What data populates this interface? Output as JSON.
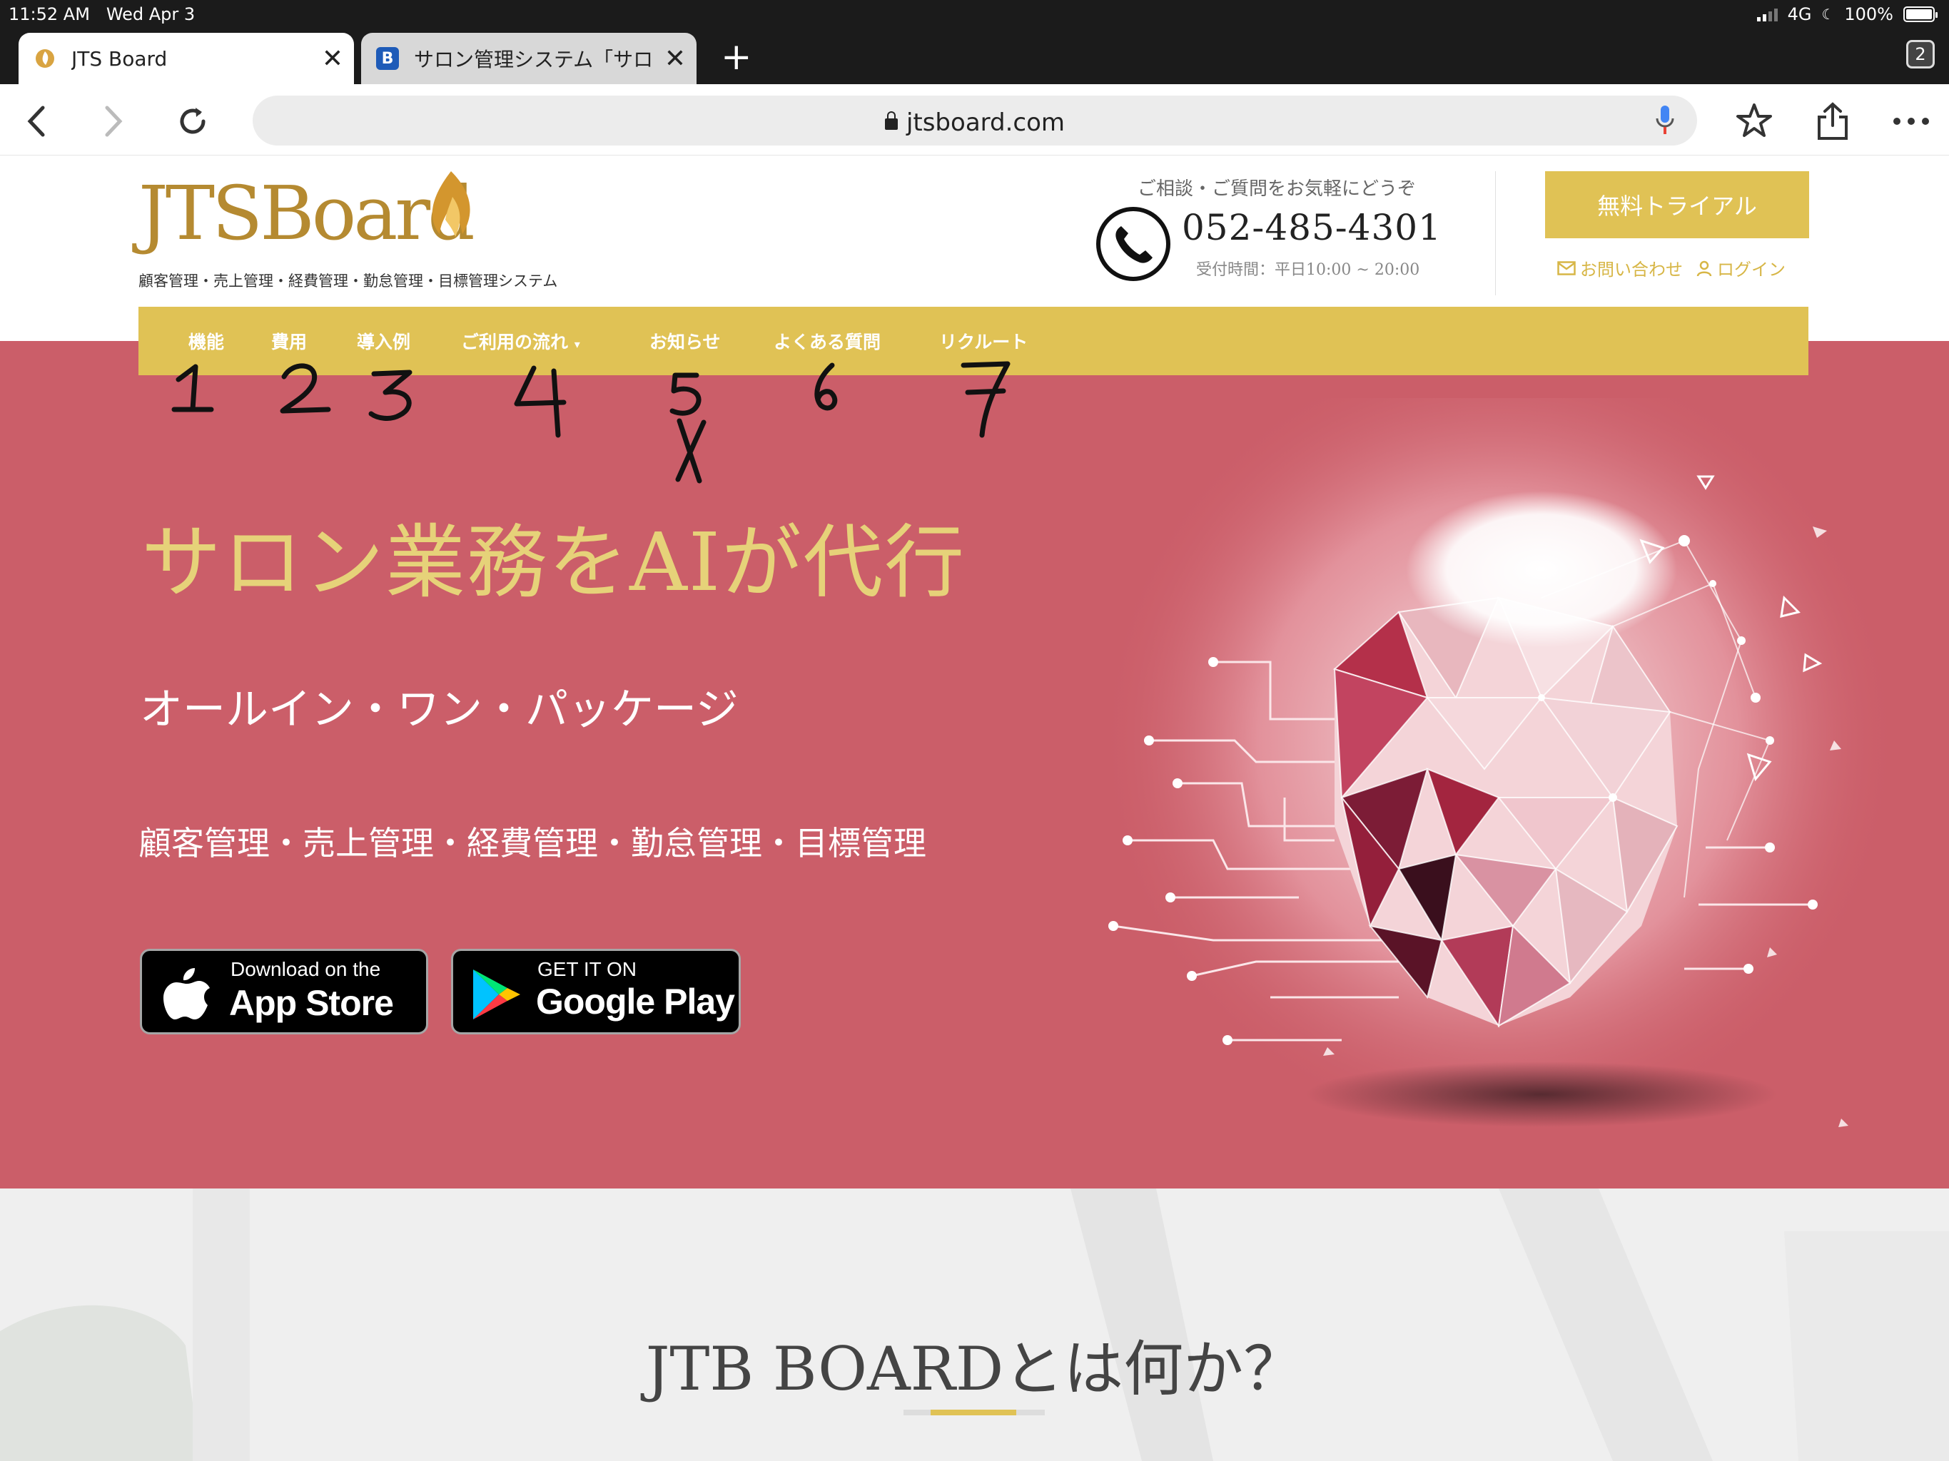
{
  "status": {
    "time": "11:52 AM",
    "date": "Wed Apr 3",
    "network": "4G",
    "battery": "100%"
  },
  "tabs": [
    {
      "title": "JTS Board",
      "favicon": "jts-flame-icon"
    },
    {
      "title": "サロン管理システム「サロ",
      "favicon": "b-icon"
    }
  ],
  "tab_count": "2",
  "address": {
    "url": "jtsboard.com"
  },
  "site": {
    "logo_text": "JTSBoard",
    "tagline": "顧客管理・売上管理・経費管理・勤怠管理・目標管理システム",
    "contact_prompt": "ご相談・ご質問をお気軽にどうぞ",
    "phone": "052-485-4301",
    "hours": "受付時間：平日10:00 ~ 20:00",
    "trial_button": "無料トライアル",
    "contact_link": "お問い合わせ",
    "login_link": "ログイン"
  },
  "nav": [
    {
      "label": "機能"
    },
    {
      "label": "費用"
    },
    {
      "label": "導入例"
    },
    {
      "label": "ご利用の流れ"
    },
    {
      "label": "お知らせ"
    },
    {
      "label": "よくある質問"
    },
    {
      "label": "リクルート"
    }
  ],
  "handwriting": [
    "1",
    "2",
    "3",
    "4",
    "5",
    "6",
    "7",
    "X"
  ],
  "hero": {
    "headline": "サロン業務をAIが代行",
    "subhead": "オールイン・ワン・パッケージ",
    "features": "顧客管理・売上管理・経費管理・勤怠管理・目標管理",
    "appstore_small": "Download on the",
    "appstore_big": "App Store",
    "gplay_small": "GET IT ON",
    "gplay_big": "Google Play"
  },
  "section": {
    "title": "JTB BOARDとは何か？"
  },
  "colors": {
    "gold": "#e0c255",
    "hero_bg": "#cb5e69",
    "headline": "#e6d279"
  }
}
